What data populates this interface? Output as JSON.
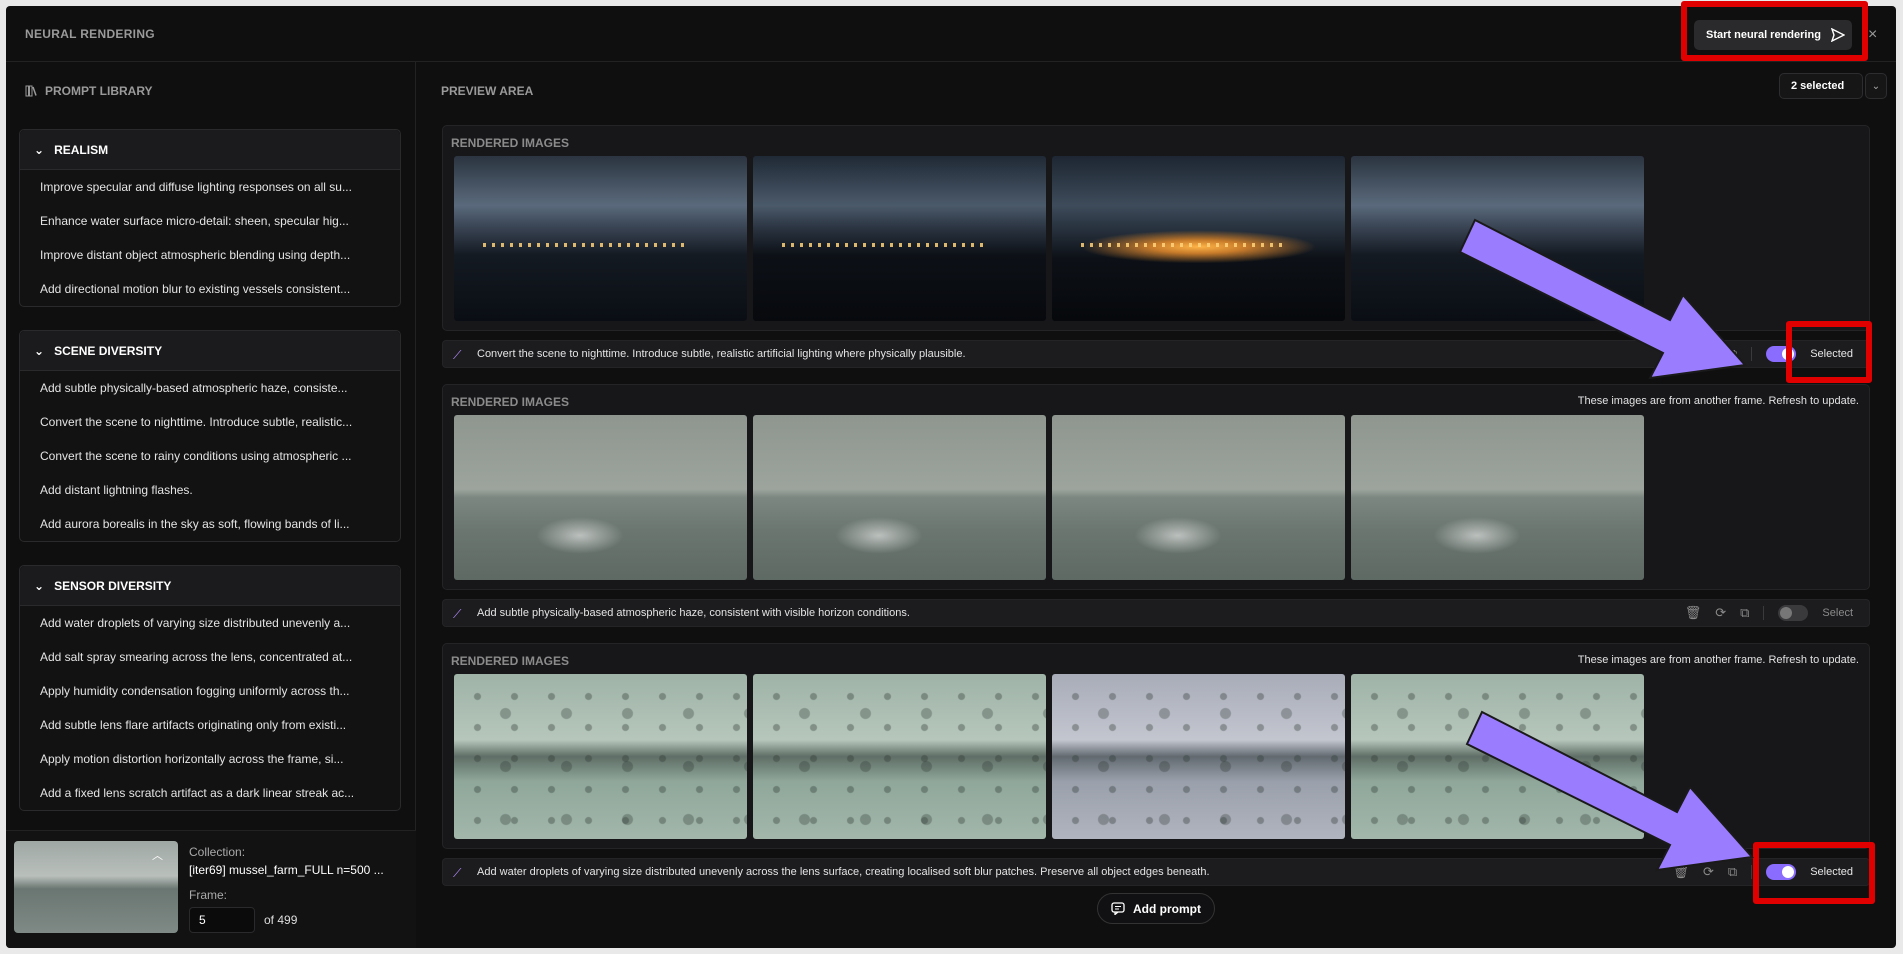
{
  "app": {
    "title": "NEURAL RENDERING",
    "start_button": "Start neural rendering",
    "close": "×"
  },
  "library": {
    "title": "PROMPT LIBRARY",
    "sections": [
      {
        "name": "REALISM",
        "items": [
          "Improve specular and diffuse lighting responses on all su...",
          "Enhance water surface micro-detail: sheen, specular hig...",
          "Improve distant object atmospheric blending using depth...",
          "Add directional motion blur to existing vessels consistent..."
        ]
      },
      {
        "name": "SCENE DIVERSITY",
        "items": [
          "Add subtle physically-based atmospheric haze, consiste...",
          "Convert the scene to nighttime. Introduce subtle, realistic...",
          "Convert the scene to rainy conditions using atmospheric ...",
          "Add distant lightning flashes.",
          "Add aurora borealis in the sky as soft, flowing bands of li..."
        ]
      },
      {
        "name": "SENSOR DIVERSITY",
        "items": [
          "Add water droplets of varying size distributed unevenly a...",
          "Add salt spray smearing across the lens, concentrated at...",
          "Apply humidity condensation fogging uniformly across th...",
          "Add subtle lens flare artifacts originating only from existi...",
          "Apply motion distortion horizontally across the frame, si...",
          "Add a fixed lens scratch artifact as a dark linear streak ac..."
        ]
      }
    ]
  },
  "collection": {
    "label": "Collection:",
    "value": "[iter69] mussel_farm_FULL n=500 ...",
    "frame_label": "Frame:",
    "frame_value": "5",
    "frame_of": "of 499"
  },
  "preview": {
    "title": "PREVIEW AREA",
    "selected_count": "2 selected",
    "cards": [
      {
        "label": "RENDERED IMAGES",
        "note": "",
        "prompt": "Convert the scene to nighttime. Introduce subtle, realistic artificial lighting where physically plausible.",
        "toggle": "Selected"
      },
      {
        "label": "RENDERED IMAGES",
        "note": "These images are from another frame. Refresh to update.",
        "prompt": "Add subtle physically-based atmospheric haze, consistent with visible horizon conditions.",
        "toggle": "Select"
      },
      {
        "label": "RENDERED IMAGES",
        "note": "These images are from another frame. Refresh to update.",
        "prompt": "Add water droplets of varying size distributed unevenly across the lens surface, creating localised soft blur patches. Preserve all object edges beneath.",
        "toggle": "Selected"
      }
    ],
    "add_prompt": "Add prompt"
  },
  "colors": {
    "accent": "#8a6cff",
    "highlight": "#e10000",
    "arrow": "#9a7cff"
  }
}
